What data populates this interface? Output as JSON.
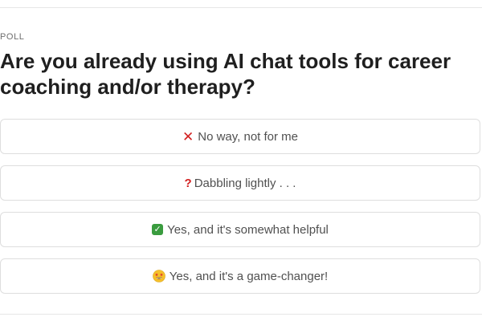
{
  "poll": {
    "label": "POLL",
    "question": "Are you already using AI chat tools for career coaching and/or therapy?",
    "options": [
      {
        "icon": "cross-mark-icon",
        "icon_glyph": "✕",
        "label": "No way, not for me"
      },
      {
        "icon": "question-mark-icon",
        "icon_glyph": "?",
        "label": "Dabbling lightly . . ."
      },
      {
        "icon": "check-mark-icon",
        "icon_glyph": "✓",
        "label": "Yes, and it's somewhat helpful"
      },
      {
        "icon": "star-struck-face-icon",
        "icon_glyph": "",
        "label": "Yes, and it's a game-changer!"
      }
    ]
  },
  "colors": {
    "cross": "#d21f1f",
    "question": "#d21f1f",
    "check": "#3a9c3f",
    "face": "#f5c02b"
  }
}
